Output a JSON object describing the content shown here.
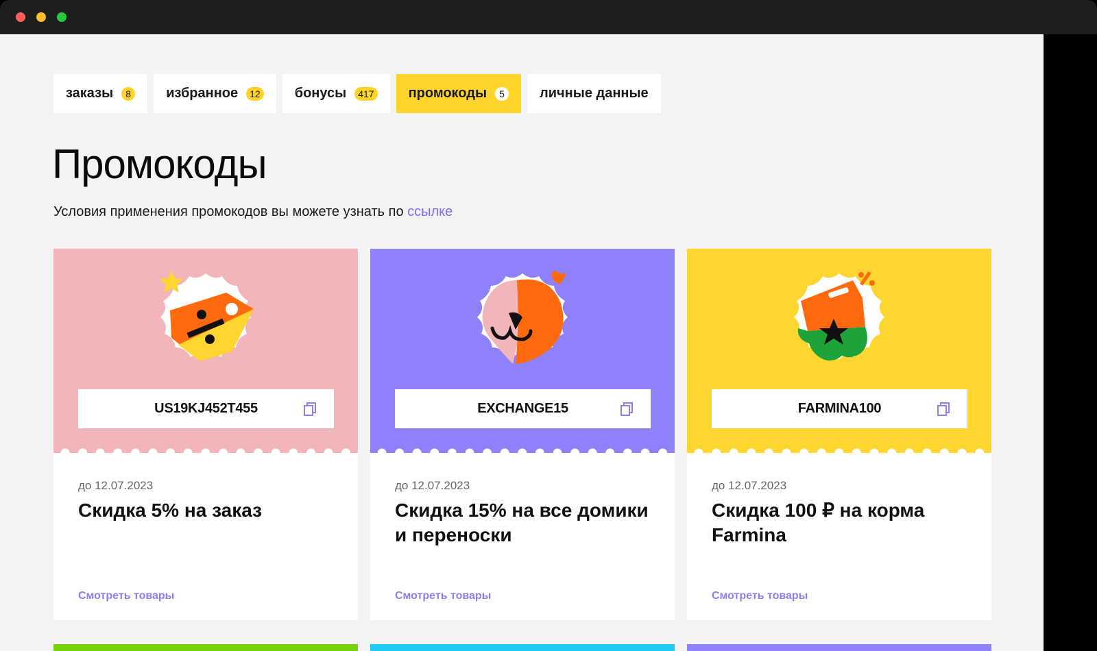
{
  "tabs": [
    {
      "label": "заказы",
      "badge": "8",
      "active": false
    },
    {
      "label": "избранное",
      "badge": "12",
      "active": false
    },
    {
      "label": "бонусы",
      "badge": "417",
      "active": false
    },
    {
      "label": "промокоды",
      "badge": "5",
      "active": true
    },
    {
      "label": "личные данные",
      "badge": "",
      "active": false
    }
  ],
  "page": {
    "title": "Промокоды",
    "subtitle_text": "Условия применения промокодов вы можете узнать по ",
    "subtitle_link": "ссылке"
  },
  "promos": [
    {
      "code": "US19KJ452T455",
      "date": "до 12.07.2023",
      "offer": "Скидка 5% на заказ",
      "link": "Смотреть товары",
      "color": "#f2b5ba",
      "icon": "discount-tag-icon"
    },
    {
      "code": "EXCHANGE15",
      "date": "до 12.07.2023",
      "offer": "Скидка 15% на все домики и переноски",
      "link": "Смотреть товары",
      "color": "#8f80fb",
      "icon": "pet-face-icon"
    },
    {
      "code": "FARMINA100",
      "date": "до 12.07.2023",
      "offer": "Скидка 100 ₽ на корма Farmina",
      "link": "Смотреть товары",
      "color": "#ffd530",
      "icon": "food-bag-icon"
    }
  ],
  "next_row_colors": [
    "#76d20d",
    "#1fcbf2",
    "#8f80fb"
  ]
}
